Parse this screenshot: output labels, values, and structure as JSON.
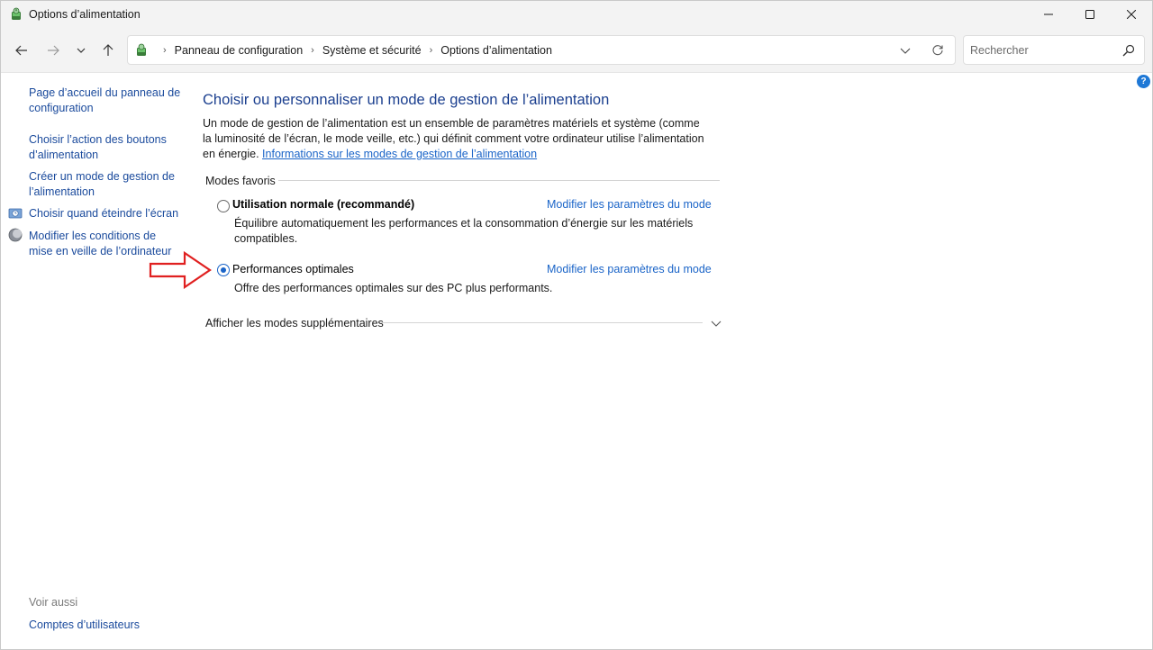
{
  "window": {
    "title": "Options d’alimentation",
    "controls": {
      "minimize": "—",
      "maximize": "☐",
      "close": "✕"
    }
  },
  "navbar": {
    "breadcrumbs": [
      "Panneau de configuration",
      "Système et sécurité",
      "Options d’alimentation"
    ],
    "separator": "›",
    "search_placeholder": "Rechercher"
  },
  "help": {
    "label": "?"
  },
  "sidebar": {
    "links": [
      "Page d’accueil du panneau de configuration",
      "Choisir l’action des boutons d’alimentation",
      "Créer un mode de gestion de l’alimentation",
      "Choisir quand éteindre l’écran",
      "Modifier les conditions de mise en veille de l’ordinateur"
    ],
    "see_also_label": "Voir aussi",
    "see_also_links": [
      "Comptes d’utilisateurs"
    ]
  },
  "main": {
    "title": "Choisir ou personnaliser un mode de gestion de l’alimentation",
    "description": "Un mode de gestion de l’alimentation est un ensemble de paramètres matériels et système (comme la luminosité de l’écran, le mode veille, etc.) qui définit comment votre ordinateur utilise l’alimentation en énergie.",
    "info_link": "Informations sur les modes de gestion de l’alimentation",
    "favorites_label": "Modes favoris",
    "plans": [
      {
        "name": "Utilisation normale (recommandé)",
        "description": "Équilibre automatiquement les performances et la consommation d’énergie sur les matériels compatibles.",
        "link": "Modifier les paramètres du mode",
        "selected": false
      },
      {
        "name": "Performances optimales",
        "description": "Offre des performances optimales sur des PC plus performants.",
        "link": "Modifier les paramètres du mode",
        "selected": true
      }
    ],
    "more_plans_label": "Afficher les modes supplémentaires"
  },
  "colors": {
    "accent": "#1a64c8",
    "link": "#1a4a9c",
    "title": "#1b3f8f",
    "annotation_arrow": "#e02020"
  }
}
